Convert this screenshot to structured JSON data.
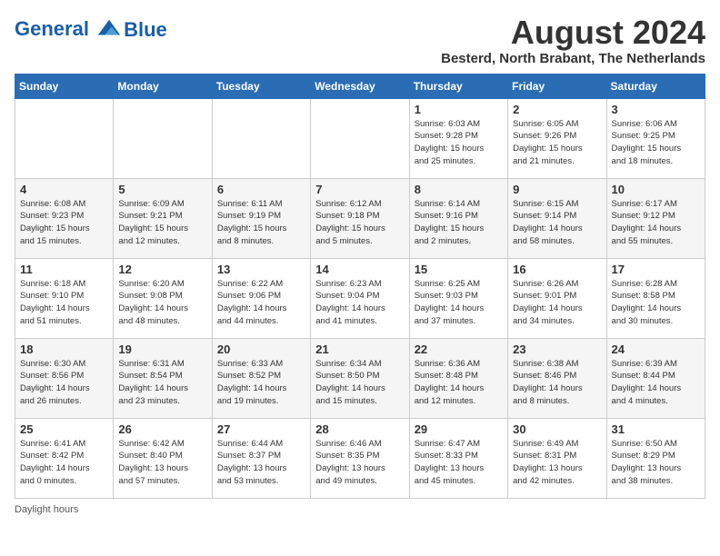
{
  "header": {
    "logo_line1": "General",
    "logo_line2": "Blue",
    "month_year": "August 2024",
    "location": "Besterd, North Brabant, The Netherlands"
  },
  "days_of_week": [
    "Sunday",
    "Monday",
    "Tuesday",
    "Wednesday",
    "Thursday",
    "Friday",
    "Saturday"
  ],
  "weeks": [
    [
      {
        "day": "",
        "info": ""
      },
      {
        "day": "",
        "info": ""
      },
      {
        "day": "",
        "info": ""
      },
      {
        "day": "",
        "info": ""
      },
      {
        "day": "1",
        "info": "Sunrise: 6:03 AM\nSunset: 9:28 PM\nDaylight: 15 hours\nand 25 minutes."
      },
      {
        "day": "2",
        "info": "Sunrise: 6:05 AM\nSunset: 9:26 PM\nDaylight: 15 hours\nand 21 minutes."
      },
      {
        "day": "3",
        "info": "Sunrise: 6:06 AM\nSunset: 9:25 PM\nDaylight: 15 hours\nand 18 minutes."
      }
    ],
    [
      {
        "day": "4",
        "info": "Sunrise: 6:08 AM\nSunset: 9:23 PM\nDaylight: 15 hours\nand 15 minutes."
      },
      {
        "day": "5",
        "info": "Sunrise: 6:09 AM\nSunset: 9:21 PM\nDaylight: 15 hours\nand 12 minutes."
      },
      {
        "day": "6",
        "info": "Sunrise: 6:11 AM\nSunset: 9:19 PM\nDaylight: 15 hours\nand 8 minutes."
      },
      {
        "day": "7",
        "info": "Sunrise: 6:12 AM\nSunset: 9:18 PM\nDaylight: 15 hours\nand 5 minutes."
      },
      {
        "day": "8",
        "info": "Sunrise: 6:14 AM\nSunset: 9:16 PM\nDaylight: 15 hours\nand 2 minutes."
      },
      {
        "day": "9",
        "info": "Sunrise: 6:15 AM\nSunset: 9:14 PM\nDaylight: 14 hours\nand 58 minutes."
      },
      {
        "day": "10",
        "info": "Sunrise: 6:17 AM\nSunset: 9:12 PM\nDaylight: 14 hours\nand 55 minutes."
      }
    ],
    [
      {
        "day": "11",
        "info": "Sunrise: 6:18 AM\nSunset: 9:10 PM\nDaylight: 14 hours\nand 51 minutes."
      },
      {
        "day": "12",
        "info": "Sunrise: 6:20 AM\nSunset: 9:08 PM\nDaylight: 14 hours\nand 48 minutes."
      },
      {
        "day": "13",
        "info": "Sunrise: 6:22 AM\nSunset: 9:06 PM\nDaylight: 14 hours\nand 44 minutes."
      },
      {
        "day": "14",
        "info": "Sunrise: 6:23 AM\nSunset: 9:04 PM\nDaylight: 14 hours\nand 41 minutes."
      },
      {
        "day": "15",
        "info": "Sunrise: 6:25 AM\nSunset: 9:03 PM\nDaylight: 14 hours\nand 37 minutes."
      },
      {
        "day": "16",
        "info": "Sunrise: 6:26 AM\nSunset: 9:01 PM\nDaylight: 14 hours\nand 34 minutes."
      },
      {
        "day": "17",
        "info": "Sunrise: 6:28 AM\nSunset: 8:58 PM\nDaylight: 14 hours\nand 30 minutes."
      }
    ],
    [
      {
        "day": "18",
        "info": "Sunrise: 6:30 AM\nSunset: 8:56 PM\nDaylight: 14 hours\nand 26 minutes."
      },
      {
        "day": "19",
        "info": "Sunrise: 6:31 AM\nSunset: 8:54 PM\nDaylight: 14 hours\nand 23 minutes."
      },
      {
        "day": "20",
        "info": "Sunrise: 6:33 AM\nSunset: 8:52 PM\nDaylight: 14 hours\nand 19 minutes."
      },
      {
        "day": "21",
        "info": "Sunrise: 6:34 AM\nSunset: 8:50 PM\nDaylight: 14 hours\nand 15 minutes."
      },
      {
        "day": "22",
        "info": "Sunrise: 6:36 AM\nSunset: 8:48 PM\nDaylight: 14 hours\nand 12 minutes."
      },
      {
        "day": "23",
        "info": "Sunrise: 6:38 AM\nSunset: 8:46 PM\nDaylight: 14 hours\nand 8 minutes."
      },
      {
        "day": "24",
        "info": "Sunrise: 6:39 AM\nSunset: 8:44 PM\nDaylight: 14 hours\nand 4 minutes."
      }
    ],
    [
      {
        "day": "25",
        "info": "Sunrise: 6:41 AM\nSunset: 8:42 PM\nDaylight: 14 hours\nand 0 minutes."
      },
      {
        "day": "26",
        "info": "Sunrise: 6:42 AM\nSunset: 8:40 PM\nDaylight: 13 hours\nand 57 minutes."
      },
      {
        "day": "27",
        "info": "Sunrise: 6:44 AM\nSunset: 8:37 PM\nDaylight: 13 hours\nand 53 minutes."
      },
      {
        "day": "28",
        "info": "Sunrise: 6:46 AM\nSunset: 8:35 PM\nDaylight: 13 hours\nand 49 minutes."
      },
      {
        "day": "29",
        "info": "Sunrise: 6:47 AM\nSunset: 8:33 PM\nDaylight: 13 hours\nand 45 minutes."
      },
      {
        "day": "30",
        "info": "Sunrise: 6:49 AM\nSunset: 8:31 PM\nDaylight: 13 hours\nand 42 minutes."
      },
      {
        "day": "31",
        "info": "Sunrise: 6:50 AM\nSunset: 8:29 PM\nDaylight: 13 hours\nand 38 minutes."
      }
    ]
  ],
  "footer": {
    "note": "Daylight hours"
  }
}
